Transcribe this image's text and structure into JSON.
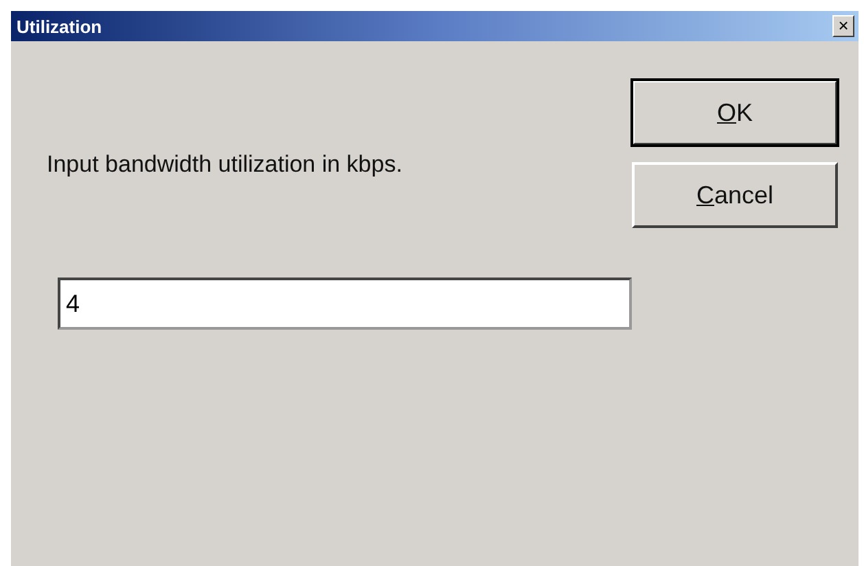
{
  "window": {
    "title": "Utilization",
    "close": "×"
  },
  "prompt": "Input bandwidth utilization in kbps.",
  "field": {
    "value": "4"
  },
  "buttons": [
    {
      "mnemonic": "O",
      "rest": "K",
      "default": true
    },
    {
      "mnemonic": "C",
      "rest": "ancel",
      "default": false
    }
  ]
}
